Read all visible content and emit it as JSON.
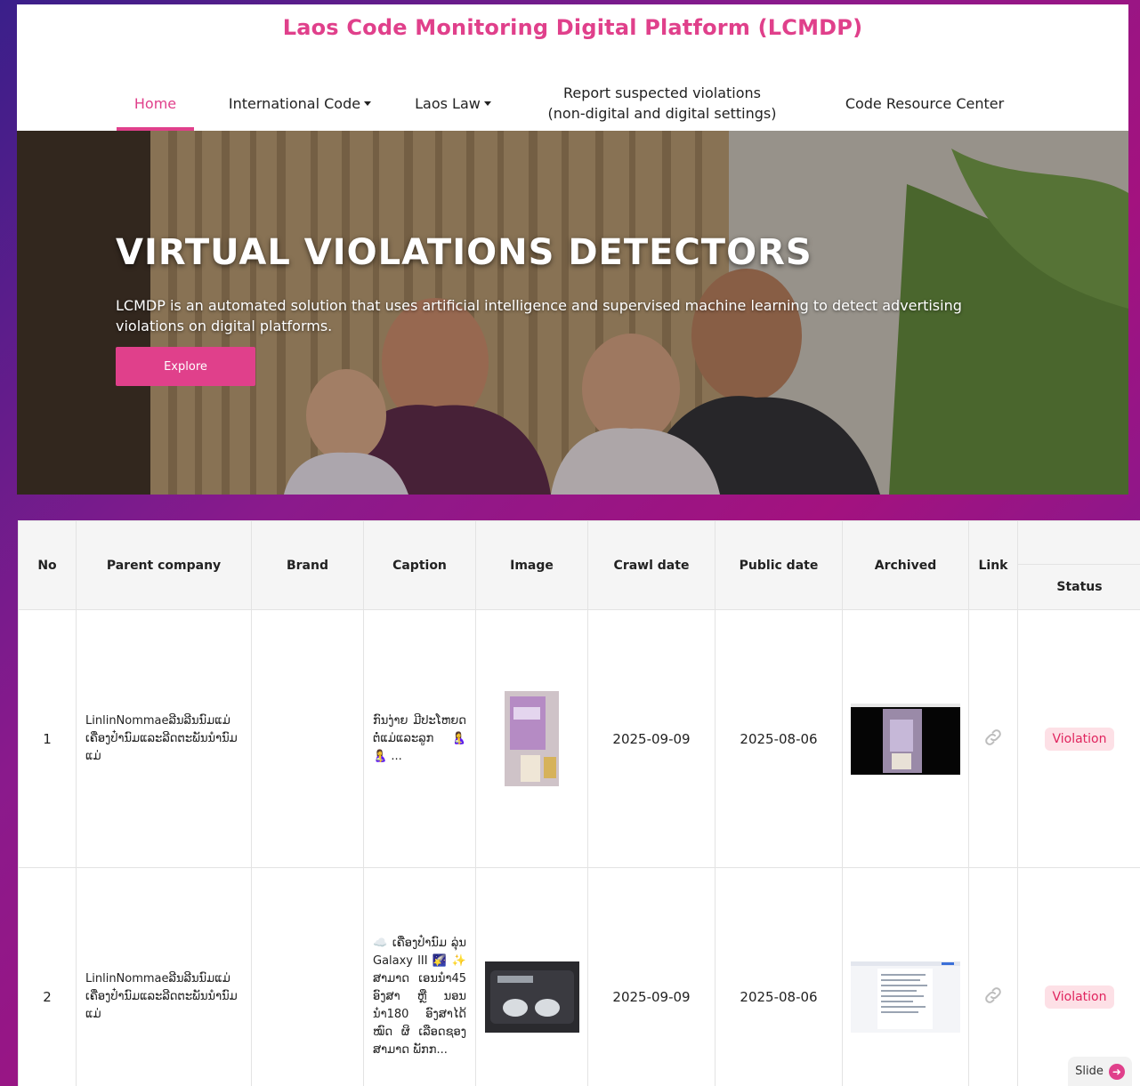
{
  "site": {
    "title": "Laos Code Monitoring Digital Platform (LCMDP)"
  },
  "nav": {
    "items": [
      {
        "label": "Home",
        "active": true
      },
      {
        "label": "International Code",
        "dropdown": true
      },
      {
        "label": "Laos Law",
        "dropdown": true
      },
      {
        "label_line1": "Report suspected violations",
        "label_line2": "(non-digital and digital settings)"
      },
      {
        "label": "Code Resource Center"
      }
    ]
  },
  "hero": {
    "heading": "VIRTUAL VIOLATIONS DETECTORS",
    "text": "LCMDP is an automated solution that uses artificial intelligence and supervised machine learning to detect advertising violations on digital platforms.",
    "button_label": "Explore"
  },
  "table": {
    "headers": {
      "no": "No",
      "parent_company": "Parent company",
      "brand": "Brand",
      "caption": "Caption",
      "image": "Image",
      "crawl_date": "Crawl date",
      "public_date": "Public date",
      "archived": "Archived",
      "link": "Link",
      "status": "Status"
    },
    "rows": [
      {
        "no": "1",
        "parent_company": "LinlinNommaeລີນລີນນົມແມ່ ເຄື່ອງປ໋ານົມແລະລີດຕະພັນນ໋ານົມແມ່",
        "brand": "",
        "caption": "ກົນງ່າຍ ມີປະໂຫຍດ ຕໍ່ແມ່ແລະລູກ 🤱 🤱 ...",
        "crawl_date": "2025-09-09",
        "public_date": "2025-08-06",
        "status": "Violation"
      },
      {
        "no": "2",
        "parent_company": "LinlinNommaeລີນລີນນົມແມ່ ເຄື່ອງປ໋ານົມແລະລີດຕະພັນນ໋ານົມແມ່",
        "brand": "",
        "caption": "☁️ ເຄື່ອງປ໋ານົມ ລຸ່ນ Galaxy III 🌠 ✨ ສາມາດ ເອນນ໋າ45 ອົງສາ ຫຼື ນອນນ໋າ180 ອົງສາໄດ້ໝົດ ຜິ ເລືອດຊອງ ສາມາດ ພັກກ...",
        "crawl_date": "2025-09-09",
        "public_date": "2025-08-06",
        "status": "Violation"
      }
    ],
    "icons": {
      "link": "link-icon"
    }
  },
  "slide": {
    "label": "Slide",
    "icon": "arrow-right-circle-icon"
  },
  "colors": {
    "accent": "#e0408b",
    "violation_bg": "#fde0e6",
    "violation_text": "#e0245e"
  }
}
